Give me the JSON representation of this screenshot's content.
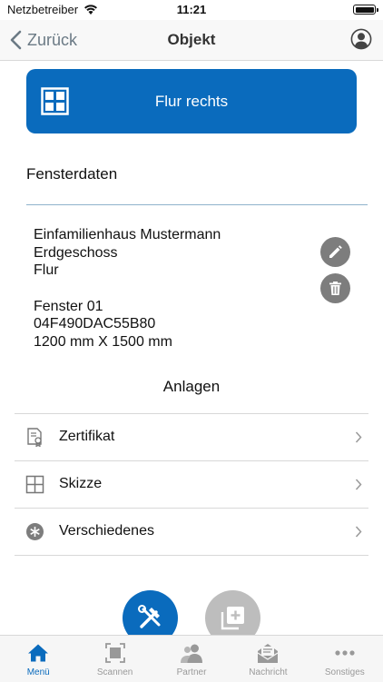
{
  "status_bar": {
    "carrier": "Netzbetreiber",
    "time": "11:21"
  },
  "nav": {
    "back_label": "Zurück",
    "title": "Objekt"
  },
  "object": {
    "title": "Flur rechts"
  },
  "section": {
    "title": "Fensterdaten"
  },
  "details": {
    "building": "Einfamilienhaus Mustermann",
    "floor": "Erdgeschoss",
    "room": "Flur",
    "window_name": "Fenster 01",
    "window_id": "04F490DAC55B80",
    "dimensions": "1200 mm X 1500 mm"
  },
  "attachments": {
    "title": "Anlagen",
    "items": [
      {
        "label": "Zertifikat",
        "icon": "certificate-icon"
      },
      {
        "label": "Skizze",
        "icon": "sketch-grid-icon"
      },
      {
        "label": "Verschiedenes",
        "icon": "asterisk-icon"
      }
    ]
  },
  "tabs": [
    {
      "label": "Menü",
      "icon": "home-icon",
      "active": true
    },
    {
      "label": "Scannen",
      "icon": "scan-icon",
      "active": false
    },
    {
      "label": "Partner",
      "icon": "partner-icon",
      "active": false
    },
    {
      "label": "Nachricht",
      "icon": "message-icon",
      "active": false
    },
    {
      "label": "Sonstiges",
      "icon": "more-icon",
      "active": false
    }
  ],
  "colors": {
    "primary": "#0a6bbd",
    "icon_gray": "#7d7d7d",
    "disabled": "#bdbdbd"
  }
}
